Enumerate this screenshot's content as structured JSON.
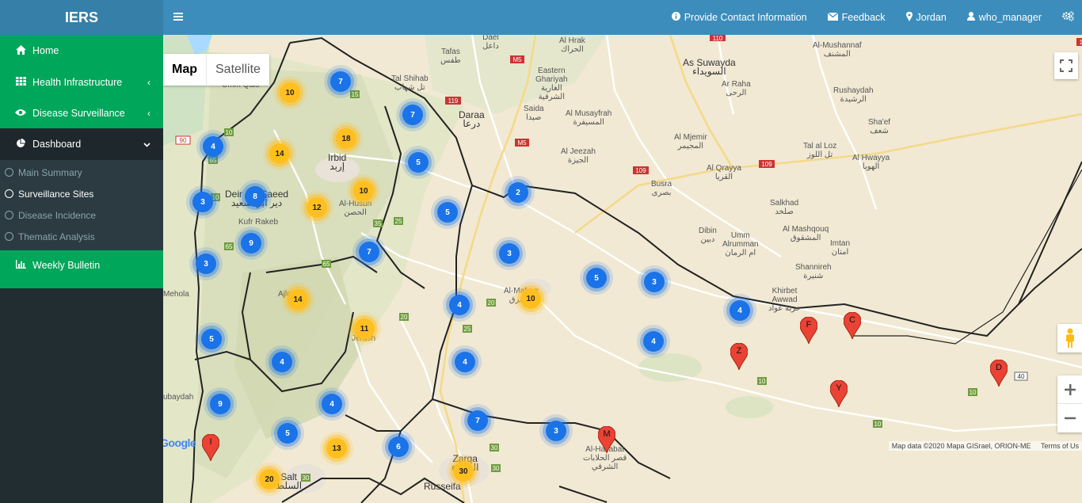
{
  "app": {
    "logo": "IERS"
  },
  "sidebar": {
    "items": [
      {
        "label": "Home",
        "icon": "home-icon"
      },
      {
        "label": "Health Infrastructure",
        "icon": "grid-icon"
      },
      {
        "label": "Disease Surveillance",
        "icon": "eye-icon"
      },
      {
        "label": "Dashboard",
        "icon": "pie-chart-icon"
      },
      {
        "label": "Weekly Bulletin",
        "icon": "bar-chart-icon"
      }
    ],
    "dashboard_sub": [
      "Main Summary",
      "Surveillance Sites",
      "Disease Incidence",
      "Thematic Analysis"
    ]
  },
  "header": {
    "provide_contact": "Provide Contact Information",
    "feedback": "Feedback",
    "location": "Jordan",
    "user": "who_manager"
  },
  "map": {
    "type_map": "Map",
    "type_satellite": "Satellite",
    "attribution": "Map data ©2020 Mapa GISrael, ORION-ME",
    "terms": "Terms of Us",
    "google": "Google",
    "places": {
      "tafas": "Tafas\nطفس",
      "dael": "Dael\nداعل",
      "alhrak": "Al Hrak\nالحراك",
      "eastern_ghariyah": "Eastern\nGhariyah\nالغارية\nالشرقية",
      "as_suwayda": "As Suwayda\nالسويداء",
      "al_mushannaf": "Al-Mushannaf\nالمشنف",
      "al_raha": "Ar Raha\nالرحى",
      "rushaydah": "Rushaydah\nالرشيدة",
      "al_shihab": "Tal Shihab\nتل شهاب",
      "daraa": "Daraa\nدرعا",
      "saida": "Saida\nصيدا",
      "al_musayfrah": "Al Musayfrah\nالمسيفرة",
      "al_mjemir": "Al Mjemir\nالمجيمر",
      "shaef": "Sha'ef\nشعف",
      "tal_al_loz": "Tal al Loz\nتل اللوز",
      "al_hwayya": "Al Hwayya\nالهويا",
      "al_jeezah": "Al Jeezah\nالجيزة",
      "al_qrayya": "Al Qrayya\nالقريا",
      "busra": "Busra\nبصرى",
      "salkhad": "Salkhad\nصلخد",
      "irbid": "Irbid\nإربد",
      "dibin": "Dibin\nدبين",
      "umm_alrumman": "Umm\nAlrumman\nام الرمان",
      "al_mashqouq": "Al Mashqouq\nالمشقوق",
      "imtan": "Imtan\nامتان",
      "shannireh": "Shannireh\nشنيرة",
      "khirbet_awwad": "Khirbet\nAwwad\nخربة عواد",
      "deir_abi_saeed": "Deir Abi Saeed\nدير أبي سعيد",
      "kufr_rakeb": "Kufr Rakeb",
      "al_husun": "Al-Husun\nالحصن",
      "al_mafraq": "Al-Mafraq\nالمفرق",
      "zarqa": "Zarqa\nالزرقاء",
      "russeifa": "Russeifa",
      "salt": "Salt\nالسلط",
      "al_hallabat": "Al-Hallabat\nقصر الحلابات\nالشرقي",
      "ajloun": "Ajloun",
      "jerash": "Jerash",
      "umm_qais": "Umm Qais",
      "mehola": "Mehola",
      "ubaydah": "ubaydah"
    },
    "clusters": [
      {
        "n": "7",
        "c": "blue"
      },
      {
        "n": "10",
        "c": "orange"
      },
      {
        "n": "7",
        "c": "blue"
      },
      {
        "n": "4",
        "c": "blue"
      },
      {
        "n": "14",
        "c": "orange"
      },
      {
        "n": "18",
        "c": "orange"
      },
      {
        "n": "5",
        "c": "blue"
      },
      {
        "n": "3",
        "c": "blue"
      },
      {
        "n": "8",
        "c": "blue"
      },
      {
        "n": "12",
        "c": "orange"
      },
      {
        "n": "10",
        "c": "orange"
      },
      {
        "n": "2",
        "c": "blue"
      },
      {
        "n": "5",
        "c": "blue"
      },
      {
        "n": "9",
        "c": "blue"
      },
      {
        "n": "7",
        "c": "blue"
      },
      {
        "n": "3",
        "c": "blue"
      },
      {
        "n": "3",
        "c": "blue"
      },
      {
        "n": "5",
        "c": "blue"
      },
      {
        "n": "3",
        "c": "blue"
      },
      {
        "n": "14",
        "c": "orange"
      },
      {
        "n": "4",
        "c": "blue"
      },
      {
        "n": "10",
        "c": "orange"
      },
      {
        "n": "4",
        "c": "blue"
      },
      {
        "n": "11",
        "c": "orange"
      },
      {
        "n": "5",
        "c": "blue"
      },
      {
        "n": "4",
        "c": "blue"
      },
      {
        "n": "4",
        "c": "blue"
      },
      {
        "n": "4",
        "c": "blue"
      },
      {
        "n": "9",
        "c": "blue"
      },
      {
        "n": "4",
        "c": "blue"
      },
      {
        "n": "7",
        "c": "blue"
      },
      {
        "n": "3",
        "c": "blue"
      },
      {
        "n": "5",
        "c": "blue"
      },
      {
        "n": "6",
        "c": "blue"
      },
      {
        "n": "13",
        "c": "orange"
      },
      {
        "n": "30",
        "c": "orange"
      },
      {
        "n": "20",
        "c": "orange"
      }
    ],
    "pins": [
      "F",
      "C",
      "Z",
      "D",
      "Y",
      "M",
      "I"
    ],
    "road_numbers": [
      "10",
      "15",
      "65",
      "90",
      "10",
      "25",
      "35",
      "65",
      "65",
      "40",
      "10",
      "10",
      "25",
      "20",
      "20",
      "30",
      "30",
      "30",
      "10",
      "109",
      "109",
      "119",
      "M5",
      "M5",
      "110",
      "110"
    ]
  }
}
